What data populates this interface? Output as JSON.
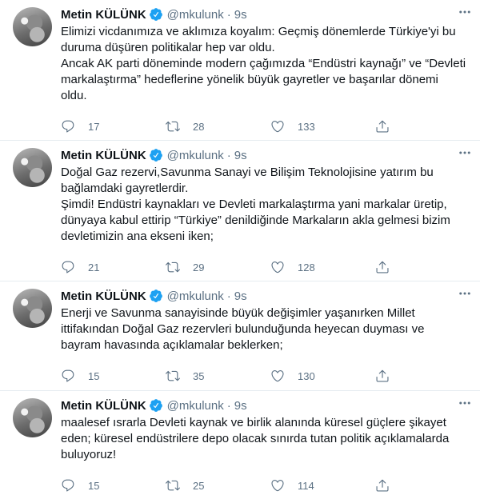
{
  "tweets": [
    {
      "name": "Metin KÜLÜNK",
      "handle": "@mkulunk",
      "separator": "·",
      "time": "9s",
      "paragraphs": [
        "Elimizi vicdanımıza ve aklımıza koyalım: Geçmiş dönemlerde Türkiye'yi bu duruma düşüren politikalar hep var oldu.",
        "Ancak AK parti döneminde modern çağımızda “Endüstri kaynağı” ve “Devleti markalaştırma” hedeflerine yönelik büyük gayretler ve başarılar dönemi oldu."
      ],
      "replies": "17",
      "retweets": "28",
      "likes": "133"
    },
    {
      "name": "Metin KÜLÜNK",
      "handle": "@mkulunk",
      "separator": "·",
      "time": "9s",
      "paragraphs": [
        "Doğal Gaz rezervi,Savunma Sanayi ve Bilişim Teknolojisine yatırım bu bağlamdaki gayretlerdir.",
        "Şimdi! Endüstri kaynakları ve Devleti markalaştırma yani markalar üretip, dünyaya kabul ettirip “Türkiye” denildiğinde Markaların akla gelmesi bizim devletimizin ana ekseni iken;"
      ],
      "replies": "21",
      "retweets": "29",
      "likes": "128"
    },
    {
      "name": "Metin KÜLÜNK",
      "handle": "@mkulunk",
      "separator": "·",
      "time": "9s",
      "paragraphs": [
        "Enerji ve Savunma sanayisinde büyük değişimler yaşanırken Millet ittifakından Doğal Gaz rezervleri bulunduğunda heyecan duyması ve bayram havasında açıklamalar beklerken;"
      ],
      "replies": "15",
      "retweets": "35",
      "likes": "130"
    },
    {
      "name": "Metin KÜLÜNK",
      "handle": "@mkulunk",
      "separator": "·",
      "time": "9s",
      "paragraphs": [
        "maalesef ısrarla Devleti kaynak ve birlik alanında küresel güçlere şikayet eden; küresel endüstrilere depo olacak sınırda tutan politik açıklamalarda buluyoruz!"
      ],
      "replies": "15",
      "retweets": "25",
      "likes": "114"
    }
  ],
  "icons": {
    "verified": "verified-badge-icon",
    "more": "more-options-icon",
    "reply": "reply-icon",
    "retweet": "retweet-icon",
    "like": "heart-icon",
    "share": "share-icon"
  },
  "colors": {
    "text": "#0f1419",
    "secondary": "#5b7083",
    "verified": "#1da1f2",
    "divider": "#e6ecf0"
  }
}
